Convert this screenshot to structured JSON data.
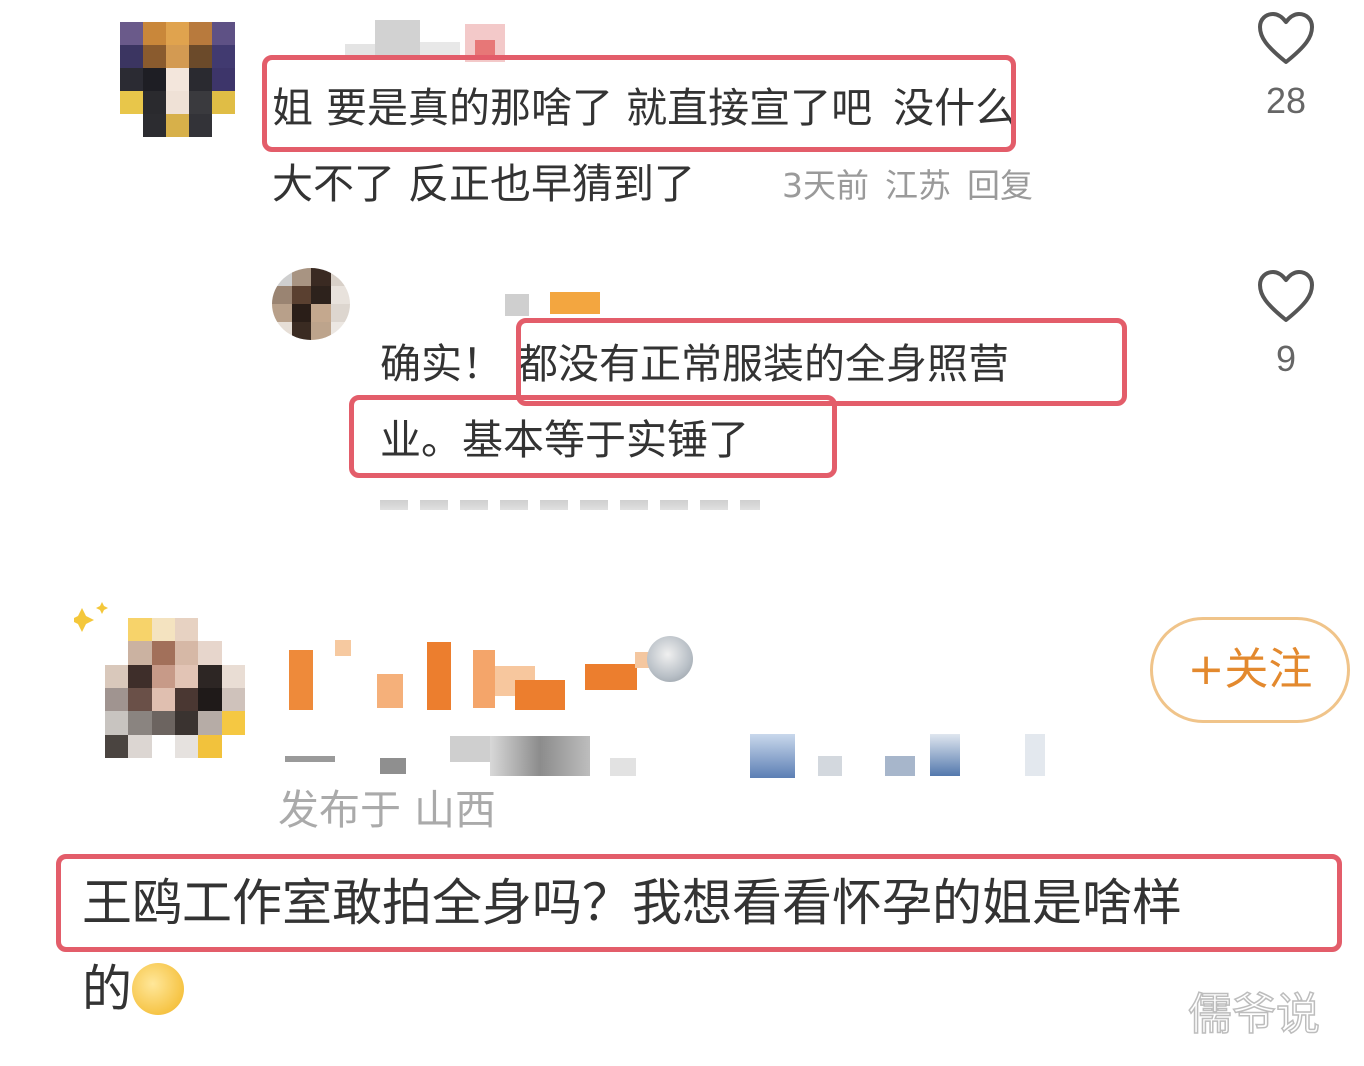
{
  "comments": [
    {
      "text_line1_hl": "姐 要是真的那啥了 就直接宣了吧",
      "text_line1_rest": "没什么",
      "text_line2": "大不了 反正也早猜到了",
      "time": "3天前",
      "location": "江苏",
      "reply_label": "回复",
      "likes": "28"
    },
    {
      "prefix": "确实！",
      "text_line1_hl": "都没有正常服装的全身照营",
      "text_line2_hl": "业。基本等于实锤了",
      "likes": "9"
    }
  ],
  "post": {
    "published_in": "发布于 山西",
    "follow_label": "+关注",
    "text_line1": "王鸥工作室敢拍全身吗？我想看看怀孕的姐是啥样",
    "text_line2": "的"
  },
  "watermark": "儒爷说",
  "colors": {
    "highlight": "#e35d6a",
    "follow_accent": "#e3892e",
    "meta_gray": "#9a9a9a"
  },
  "icons": {
    "like": "heart-outline-icon",
    "emoji": "smiling-face-emoji-icon"
  }
}
